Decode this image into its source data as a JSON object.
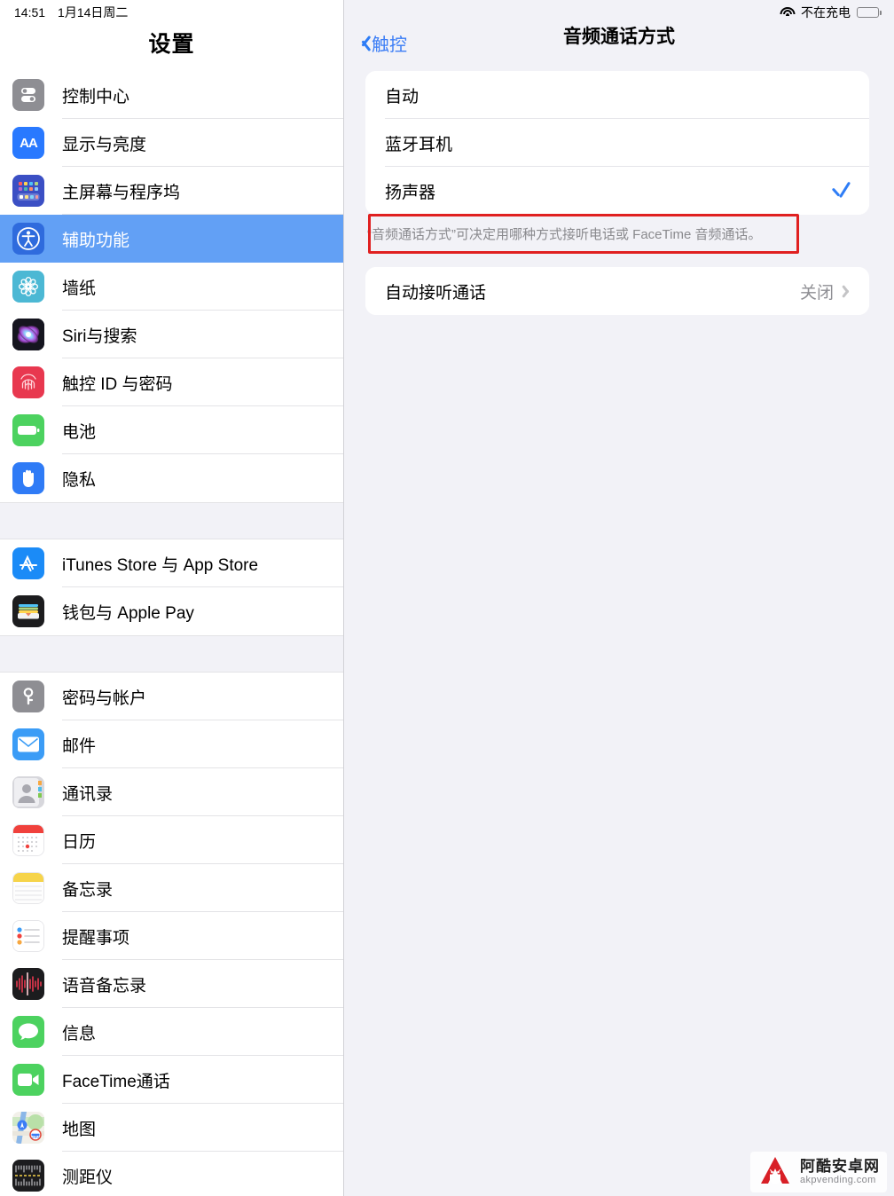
{
  "status_bar": {
    "time": "14:51",
    "date": "1月14日周二",
    "wifi_icon": "wifi-icon",
    "battery_label": "不在充电",
    "battery_icon": "battery-icon"
  },
  "sidebar": {
    "title": "设置",
    "sections": [
      {
        "items": [
          {
            "label": "控制中心",
            "icon": "control-center-icon",
            "selected": false
          },
          {
            "label": "显示与亮度",
            "icon": "display-brightness-icon",
            "selected": false
          },
          {
            "label": "主屏幕与程序坞",
            "icon": "home-screen-dock-icon",
            "selected": false
          },
          {
            "label": "辅助功能",
            "icon": "accessibility-icon",
            "selected": true
          },
          {
            "label": "墙纸",
            "icon": "wallpaper-icon",
            "selected": false
          },
          {
            "label": "Siri与搜索",
            "icon": "siri-icon",
            "selected": false
          },
          {
            "label": "触控 ID 与密码",
            "icon": "touch-id-icon",
            "selected": false
          },
          {
            "label": "电池",
            "icon": "battery-settings-icon",
            "selected": false
          },
          {
            "label": "隐私",
            "icon": "privacy-hand-icon",
            "selected": false
          }
        ]
      },
      {
        "items": [
          {
            "label": "iTunes Store 与 App Store",
            "icon": "app-store-icon",
            "selected": false
          },
          {
            "label": "钱包与 Apple Pay",
            "icon": "wallet-icon",
            "selected": false
          }
        ]
      },
      {
        "items": [
          {
            "label": "密码与帐户",
            "icon": "passwords-accounts-icon",
            "selected": false
          },
          {
            "label": "邮件",
            "icon": "mail-icon",
            "selected": false
          },
          {
            "label": "通讯录",
            "icon": "contacts-icon",
            "selected": false
          },
          {
            "label": "日历",
            "icon": "calendar-icon",
            "selected": false
          },
          {
            "label": "备忘录",
            "icon": "notes-icon",
            "selected": false
          },
          {
            "label": "提醒事项",
            "icon": "reminders-icon",
            "selected": false
          },
          {
            "label": "语音备忘录",
            "icon": "voice-memos-icon",
            "selected": false
          },
          {
            "label": "信息",
            "icon": "messages-icon",
            "selected": false
          },
          {
            "label": "FaceTime通话",
            "icon": "facetime-icon",
            "selected": false
          },
          {
            "label": "地图",
            "icon": "maps-icon",
            "selected": false
          },
          {
            "label": "测距仪",
            "icon": "measure-icon",
            "selected": false
          }
        ]
      }
    ]
  },
  "detail": {
    "back_label": "触控",
    "back_icon": "chevron-left-icon",
    "title": "音频通话方式",
    "options": [
      {
        "label": "自动",
        "checked": false
      },
      {
        "label": "蓝牙耳机",
        "checked": false
      },
      {
        "label": "扬声器",
        "checked": true
      }
    ],
    "options_footer": "“音频通话方式”可决定用哪种方式接听电话或 FaceTime 音频通话。",
    "auto_answer": {
      "label": "自动接听通话",
      "value": "关闭",
      "chevron_icon": "chevron-right-icon"
    },
    "selected_checkmark_icon": "checkmark-icon"
  },
  "annotation": {
    "highlight_color": "#e02020",
    "highlight_target": "扬声器"
  },
  "watermark": {
    "logo_letter": "A",
    "site_name_cn": "阿酷安卓网",
    "site_url": "akpvending.com"
  },
  "colors": {
    "accent_blue": "#2e7df6",
    "selection_blue": "#62a0f5",
    "group_background": "#f2f2f7",
    "secondary_text": "#8e8e93"
  }
}
